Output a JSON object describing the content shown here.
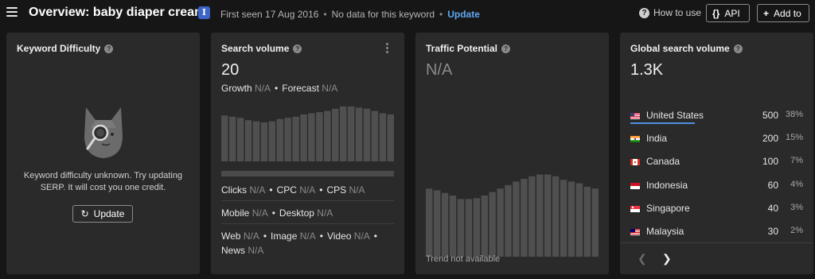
{
  "header": {
    "title": "Overview: baby diaper cream",
    "info_badge": "I",
    "first_seen": "First seen 17 Aug 2016",
    "no_data": "No data for this keyword",
    "update_link": "Update",
    "how_to_use": "How to use",
    "api_icon": "{}",
    "api_label": "API",
    "add_icon": "+",
    "add_label": "Add to"
  },
  "keyword_difficulty": {
    "title": "Keyword Difficulty",
    "message": "Keyword difficulty unknown. Try updating SERP. It will cost you one credit.",
    "update_button": "Update",
    "update_icon": "refresh-icon"
  },
  "search_volume": {
    "title": "Search volume",
    "value": "20",
    "growth_label": "Growth",
    "growth_value": "N/A",
    "forecast_label": "Forecast",
    "forecast_value": "N/A",
    "clicks_label": "Clicks",
    "clicks_value": "N/A",
    "cpc_label": "CPC",
    "cpc_value": "N/A",
    "cps_label": "CPS",
    "cps_value": "N/A",
    "mobile_label": "Mobile",
    "mobile_value": "N/A",
    "desktop_label": "Desktop",
    "desktop_value": "N/A",
    "web_label": "Web",
    "web_value": "N/A",
    "image_label": "Image",
    "image_value": "N/A",
    "video_label": "Video",
    "video_value": "N/A",
    "news_label": "News",
    "news_value": "N/A",
    "bar_color": "#4f4f4f"
  },
  "traffic_potential": {
    "title": "Traffic Potential",
    "value": "N/A",
    "trend_note": "Trend not available",
    "bar_color": "#4f4f4f"
  },
  "global_volume": {
    "title": "Global search volume",
    "value": "1.3K",
    "accent": "#4d8fe0",
    "countries": [
      {
        "name": "United States",
        "volume": "500",
        "percent": "38%",
        "share": 0.38,
        "flag": "us-flag"
      },
      {
        "name": "India",
        "volume": "200",
        "percent": "15%",
        "share": 0.15,
        "flag": "in-flag"
      },
      {
        "name": "Canada",
        "volume": "100",
        "percent": "7%",
        "share": 0.07,
        "flag": "ca-flag"
      },
      {
        "name": "Indonesia",
        "volume": "60",
        "percent": "4%",
        "share": 0.04,
        "flag": "id-flag"
      },
      {
        "name": "Singapore",
        "volume": "40",
        "percent": "3%",
        "share": 0.03,
        "flag": "sg-flag"
      },
      {
        "name": "Malaysia",
        "volume": "30",
        "percent": "2%",
        "share": 0.02,
        "flag": "my-flag"
      }
    ],
    "prev_icon": "chevron-left-icon",
    "next_icon": "chevron-right-icon"
  }
}
